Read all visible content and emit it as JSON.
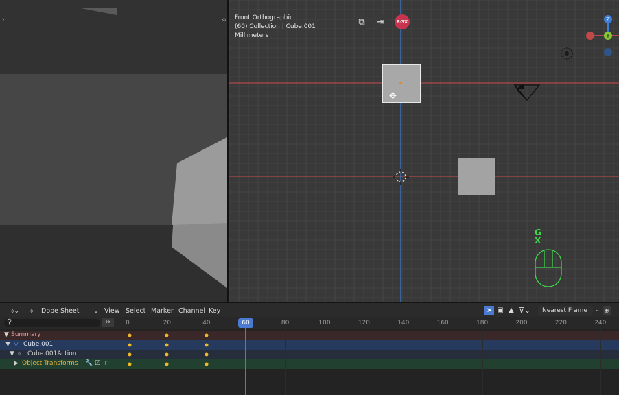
{
  "viewport": {
    "view_name": "Front Orthographic",
    "collection": "(60) Collection | Cube.001",
    "units": "Millimeters",
    "hud_badge": "RGX",
    "gizmo": {
      "z": "Z",
      "y": "Y"
    },
    "key_hint_primary": "G",
    "key_hint_secondary": "X"
  },
  "dope_sheet": {
    "mode_label": "Dope Sheet",
    "menus": [
      "View",
      "Select",
      "Marker",
      "Channel",
      "Key"
    ],
    "snap_mode": "Nearest Frame",
    "current_frame": "60",
    "frame_ticks": [
      "0",
      "20",
      "40",
      "60",
      "80",
      "100",
      "120",
      "140",
      "160",
      "180",
      "200",
      "220",
      "240"
    ],
    "channels": [
      {
        "label": "Summary",
        "color": "#e79c9c"
      },
      {
        "label": "Cube.001",
        "color": "#dfe6f5"
      },
      {
        "label": "Cube.001Action",
        "color": "#cfcfcf"
      },
      {
        "label": "Object Transforms",
        "color": "#e8b33a"
      }
    ]
  },
  "colors": {
    "accent_blue": "#4a7bd1",
    "summary_row": "#3a2828",
    "object_row": "#253a5c",
    "group_row": "#21402f",
    "keyframe": "#f1b92a",
    "x_axis": "#b04a4a",
    "z_axis": "#3d7fd6"
  }
}
